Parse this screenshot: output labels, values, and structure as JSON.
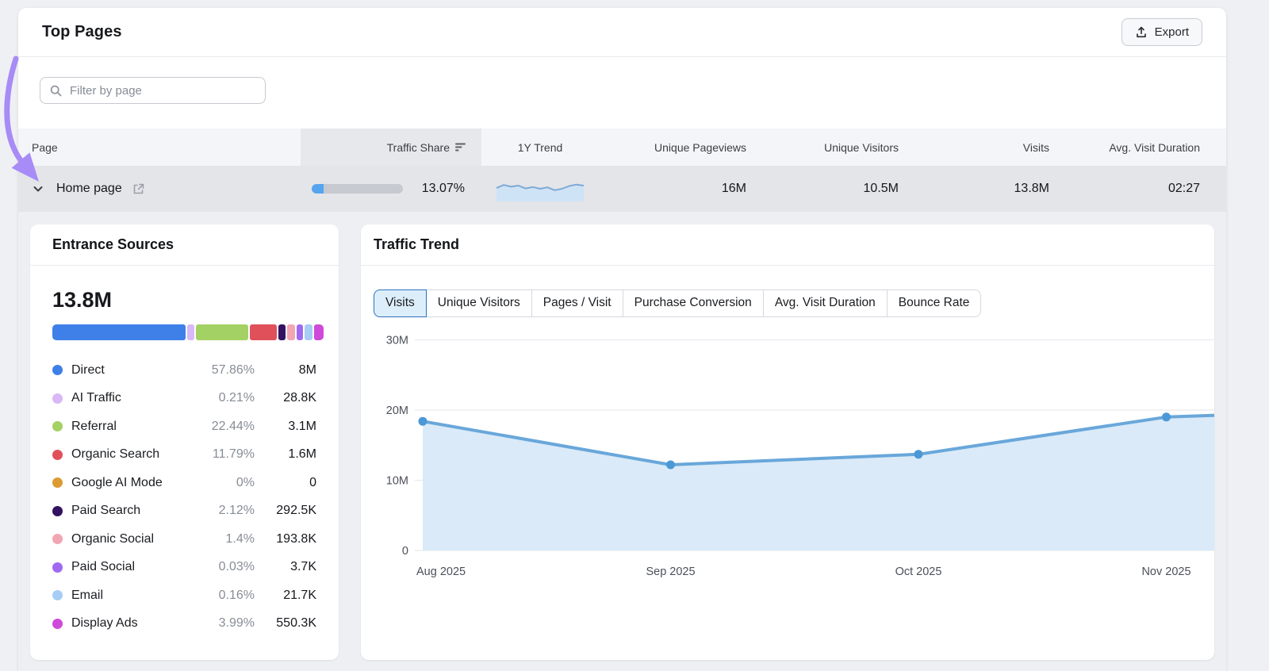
{
  "header": {
    "title": "Top Pages",
    "export_label": "Export"
  },
  "filter": {
    "placeholder": "Filter by page"
  },
  "table": {
    "columns": [
      "Page",
      "Traffic Share",
      "1Y Trend",
      "Unique Pageviews",
      "Unique Visitors",
      "Visits",
      "Avg. Visit Duration"
    ],
    "row": {
      "page": "Home page",
      "traffic_share_label": "13.07%",
      "traffic_share_pct": 13.07,
      "unique_pageviews": "16M",
      "unique_visitors": "10.5M",
      "visits": "13.8M",
      "avg_visit_duration": "02:27"
    }
  },
  "entrance_sources": {
    "title": "Entrance Sources",
    "total": "13.8M",
    "items": [
      {
        "label": "Direct",
        "percent": "57.86%",
        "value": "8M",
        "color": "#3f7fe8",
        "bar": 50.5
      },
      {
        "label": "AI Traffic",
        "percent": "0.21%",
        "value": "28.8K",
        "color": "#d9b8f7",
        "bar": 2.6
      },
      {
        "label": "Referral",
        "percent": "22.44%",
        "value": "3.1M",
        "color": "#a4d163",
        "bar": 20.0
      },
      {
        "label": "Organic Search",
        "percent": "11.79%",
        "value": "1.6M",
        "color": "#e0505b",
        "bar": 10.2
      },
      {
        "label": "Google AI Mode",
        "percent": "0%",
        "value": "0",
        "color": "#dc9a33",
        "bar": 0
      },
      {
        "label": "Paid Search",
        "percent": "2.12%",
        "value": "292.5K",
        "color": "#331261",
        "bar": 2.6
      },
      {
        "label": "Organic Social",
        "percent": "1.4%",
        "value": "193.8K",
        "color": "#f2a6b2",
        "bar": 2.9
      },
      {
        "label": "Paid Social",
        "percent": "0.03%",
        "value": "3.7K",
        "color": "#9f6af0",
        "bar": 2.6
      },
      {
        "label": "Email",
        "percent": "0.16%",
        "value": "21.7K",
        "color": "#a8cdf4",
        "bar": 2.9
      },
      {
        "label": "Display Ads",
        "percent": "3.99%",
        "value": "550.3K",
        "color": "#ce4ad8",
        "bar": 3.7
      }
    ]
  },
  "traffic_trend": {
    "title": "Traffic Trend",
    "tabs": [
      {
        "label": "Visits",
        "active": true
      },
      {
        "label": "Unique Visitors",
        "active": false
      },
      {
        "label": "Pages / Visit",
        "active": false
      },
      {
        "label": "Purchase Conversion",
        "active": false
      },
      {
        "label": "Avg. Visit Duration",
        "active": false
      },
      {
        "label": "Bounce Rate",
        "active": false
      }
    ]
  },
  "chart_data": [
    {
      "id": "traffic-trend",
      "type": "area",
      "title": "Traffic Trend",
      "metric": "Visits",
      "x": [
        "Aug 2025",
        "Sep 2025",
        "Oct 2025",
        "Nov 2025"
      ],
      "values_millions": [
        18.4,
        12.2,
        13.7,
        19.0
      ],
      "right_edge_value_millions": 19.3,
      "yticks": [
        "0",
        "10M",
        "20M",
        "30M"
      ],
      "ylim_millions": [
        0,
        30
      ],
      "grid": true,
      "legend": "none",
      "line_color": "#69a7da",
      "fill_color": "#daeaf8",
      "point_color": "#4b98d6"
    },
    {
      "id": "one-year-trend-sparkline",
      "type": "area",
      "title": "1Y Trend sparkline",
      "values_norm": [
        0.55,
        0.72,
        0.62,
        0.68,
        0.52,
        0.6,
        0.5,
        0.58,
        0.42,
        0.5,
        0.66,
        0.74,
        0.68
      ],
      "line_color": "#7fa9d4",
      "fill_color": "#cfe3f6"
    }
  ],
  "colors": {
    "annotation_arrow": "#a78bf6",
    "progress_fill": "#55a4ef",
    "progress_track": "#c6c9cf",
    "grid_line": "#e8eaed",
    "axis_text": "#4b5058"
  }
}
